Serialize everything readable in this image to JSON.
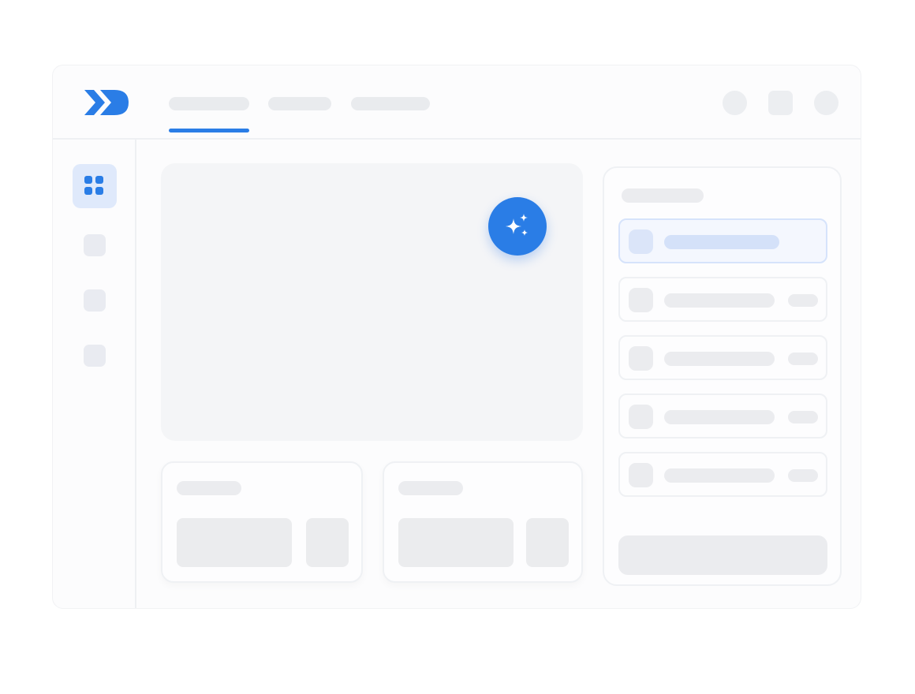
{
  "theme": {
    "accent": "#2a7de6",
    "accent_light": "#dfe9fb",
    "placeholder": "#ebecef"
  },
  "logo": {
    "icon": "double-chevron-logo-icon"
  },
  "nav": {
    "tabs": [
      {
        "name": "tab-1",
        "active": true
      },
      {
        "name": "tab-2",
        "active": false
      },
      {
        "name": "tab-3",
        "active": false
      }
    ]
  },
  "toolbar": {
    "icons": [
      "round-action-icon",
      "square-action-icon",
      "profile-circle-icon"
    ]
  },
  "sidebar": {
    "items": [
      {
        "icon": "grid-icon",
        "active": true
      },
      {
        "icon": "placeholder-icon",
        "active": false
      },
      {
        "icon": "placeholder-icon",
        "active": false
      },
      {
        "icon": "placeholder-icon",
        "active": false
      }
    ],
    "footer": {
      "icon": "avatar"
    }
  },
  "main": {
    "hero": {
      "action_icon": "sparkles-icon"
    },
    "cards": [
      {
        "kind": "summary-card"
      },
      {
        "kind": "summary-card"
      }
    ]
  },
  "panel": {
    "rows": [
      {
        "selected": true
      },
      {
        "selected": false
      },
      {
        "selected": false
      },
      {
        "selected": false
      },
      {
        "selected": false
      }
    ]
  }
}
